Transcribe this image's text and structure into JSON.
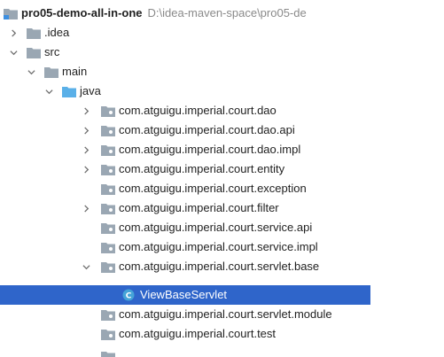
{
  "project": {
    "name": "pro05-demo-all-in-one",
    "path": "D:\\idea-maven-space\\pro05-de"
  },
  "nodes": {
    "idea": ".idea",
    "src": "src",
    "main": "main",
    "java": "java",
    "pkg_dao": "com.atguigu.imperial.court.dao",
    "pkg_dao_api": "com.atguigu.imperial.court.dao.api",
    "pkg_dao_impl": "com.atguigu.imperial.court.dao.impl",
    "pkg_entity": "com.atguigu.imperial.court.entity",
    "pkg_exception": "com.atguigu.imperial.court.exception",
    "pkg_filter": "com.atguigu.imperial.court.filter",
    "pkg_service_api": "com.atguigu.imperial.court.service.api",
    "pkg_service_impl": "com.atguigu.imperial.court.service.impl",
    "pkg_servlet_base": "com.atguigu.imperial.court.servlet.base",
    "class_view_base_servlet": "ViewBaseServlet",
    "pkg_servlet_module": "com.atguigu.imperial.court.servlet.module",
    "pkg_test": "com.atguigu.imperial.court.test"
  },
  "colors": {
    "selection": "#2f65ca",
    "folder": "#9aa7b3",
    "source_folder": "#5ab0e8",
    "module_blue": "#3d8fe0",
    "class_icon": "#45a4d8"
  }
}
